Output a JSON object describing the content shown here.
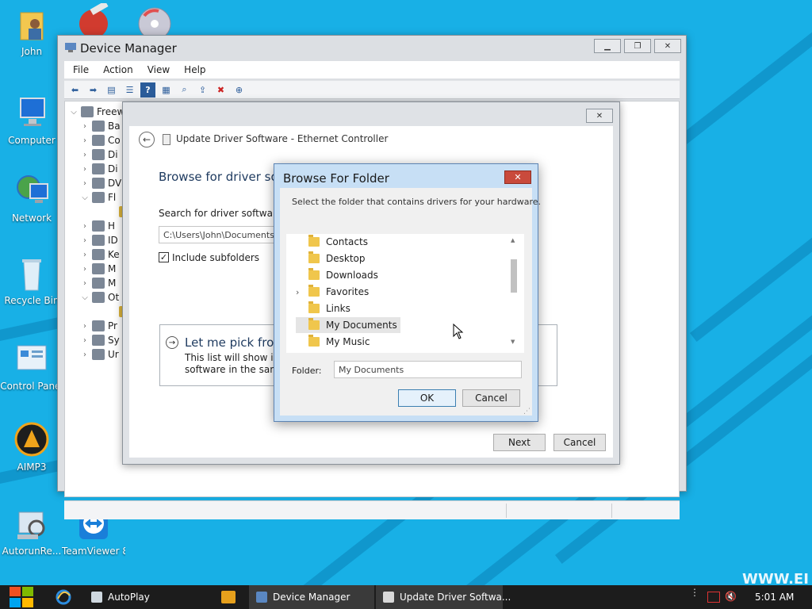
{
  "desktop": {
    "icons": [
      {
        "label": "John"
      },
      {
        "label": "Computer"
      },
      {
        "label": "Network"
      },
      {
        "label": "Recycle Bin"
      },
      {
        "label": "Control Panel"
      },
      {
        "label": "AIMP3"
      },
      {
        "label": "AutorunRe..."
      },
      {
        "label": "TeamViewer 8"
      }
    ],
    "watermark": "WWW.EI"
  },
  "device_manager": {
    "title": "Device Manager",
    "menu": [
      "File",
      "Action",
      "View",
      "Help"
    ],
    "tree_root": "Freew",
    "tree_items": [
      "Ba",
      "Co",
      "Di",
      "Di",
      "DV",
      "Fl",
      "",
      "H",
      "ID",
      "Ke",
      "M",
      "M",
      "Ot",
      "",
      "Pr",
      "Sy",
      "Ur"
    ]
  },
  "update_driver": {
    "title": "Update Driver Software - Ethernet Controller",
    "heading": "Browse for driver sof",
    "search_label": "Search for driver software in",
    "path_value": "C:\\Users\\John\\Documents",
    "include_subfolders": "Include subfolders",
    "pick_title": "Let me pick from",
    "pick_desc_1": "This list will show inst",
    "pick_desc_2": "software in the same",
    "next_label": "Next",
    "cancel_label": "Cancel"
  },
  "browse_folder": {
    "title": "Browse For Folder",
    "instruction": "Select the folder that contains drivers for your hardware.",
    "folders": [
      {
        "name": "Contacts"
      },
      {
        "name": "Desktop"
      },
      {
        "name": "Downloads"
      },
      {
        "name": "Favorites"
      },
      {
        "name": "Links"
      },
      {
        "name": "My Documents"
      },
      {
        "name": "My Music"
      }
    ],
    "folder_label": "Folder:",
    "folder_value": "My Documents",
    "ok_label": "OK",
    "cancel_label": "Cancel"
  },
  "taskbar": {
    "items": [
      {
        "label": "AutoPlay"
      },
      {
        "label": "Device Manager"
      },
      {
        "label": "Update Driver Softwa..."
      }
    ],
    "clock": "5:01 AM"
  }
}
